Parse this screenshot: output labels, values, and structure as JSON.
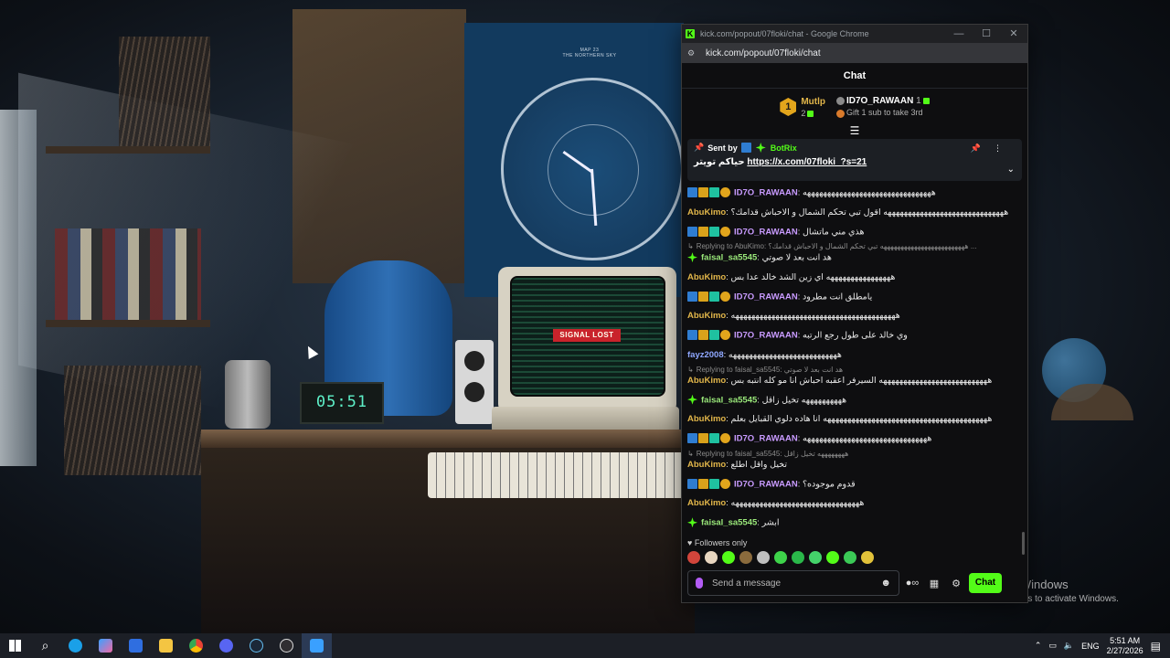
{
  "desktop": {
    "poster_title": "MAP 23\nTHE NORTHERN SKY",
    "alarm_time": "05:51",
    "screen_label": "SIGNAL LOST",
    "activate_line1": "Activate Windows",
    "activate_line2": "Go to Settings to activate Windows."
  },
  "window": {
    "title": "kick.com/popout/07floki/chat - Google Chrome",
    "url": "kick.com/popout/07floki/chat",
    "minimize_glyph": "—",
    "maximize_glyph": "☐",
    "close_glyph": "✕"
  },
  "chat": {
    "header": "Chat",
    "leaderboard": [
      {
        "rank": "1",
        "name": "Mutlp",
        "sub": "2"
      },
      {
        "name": "ID7O_RAWAAN",
        "count": "1",
        "sub": "Gift 1 sub to take 3rd"
      }
    ],
    "pinned": {
      "sent_by": "Sent by",
      "bot_name": "BotRix",
      "text": "حياكم تويتر",
      "link": "https://x.com/07floki_?s=21"
    },
    "messages": [
      {
        "user": "ID7O_RAWAAN",
        "color": "purple",
        "badges": [
          "blue",
          "gold",
          "teal",
          "coin"
        ],
        "text": "ههههههههههههههههههههههههههههههههه"
      },
      {
        "user": "AbuKimo",
        "color": "gold",
        "badges": [],
        "text": "ههههههههههههههههههههههههههههههه اقول تبي تحكم الشمال و الاحباش قدامك؟"
      },
      {
        "user": "ID7O_RAWAAN",
        "color": "purple",
        "badges": [
          "blue",
          "gold",
          "teal",
          "coin"
        ],
        "text": "هذي مني ماتشال"
      },
      {
        "reply": "Replying to AbuKimo: هههههههههههههههههههههههههه تبي تحكم الشمال و الاحباش قدامك؟ ...",
        "user": "faisal_sa5545",
        "color": "green",
        "badges": [
          "spark"
        ],
        "text": "هد انت بعد لا صوتي"
      },
      {
        "user": "AbuKimo",
        "color": "gold",
        "badges": [],
        "text": "ههههههههههههههههه اي زين الشد خالد عدا بس"
      },
      {
        "user": "ID7O_RAWAAN",
        "color": "purple",
        "badges": [
          "blue",
          "gold",
          "teal",
          "coin"
        ],
        "text": "يامطلق انت مطرود"
      },
      {
        "user": "AbuKimo",
        "color": "gold",
        "badges": [],
        "text": "هههههههههههههههههههههههههههههههههههههههههه"
      },
      {
        "user": "ID7O_RAWAAN",
        "color": "purple",
        "badges": [
          "blue",
          "gold",
          "teal",
          "coin"
        ],
        "text": "وي خالد على طول رجع الرتبه"
      },
      {
        "user": "fayz2008",
        "color": "blue",
        "badges": [],
        "text": "هههههههههههههههههههههههههههه"
      },
      {
        "reply": "Replying to faisal_sa5545: هد انت بعد لا صوتي",
        "user": "AbuKimo",
        "color": "gold",
        "badges": [],
        "text": "هههههههههههههههههههههههههههه السيرفر اعقبه احباش انا مو كله انتبه بس"
      },
      {
        "user": "faisal_sa5545",
        "color": "green",
        "badges": [
          "spark"
        ],
        "text": "ههههههههههه تخيل زاقل"
      },
      {
        "user": "AbuKimo",
        "color": "gold",
        "badges": [],
        "text": "هههههههههههههههههههههههههههههههههههههههههه انا هاده دلوي القبايل بعلم"
      },
      {
        "user": "ID7O_RAWAAN",
        "color": "purple",
        "badges": [
          "blue",
          "gold",
          "teal",
          "coin"
        ],
        "text": "هههههههههههههههههههههههههههههههه"
      },
      {
        "reply": "Replying to faisal_sa5545: ههههههههه تخيل زاقل",
        "user": "AbuKimo",
        "color": "gold",
        "badges": [],
        "text": "تخيل واقل اطلع"
      },
      {
        "user": "ID7O_RAWAAN",
        "color": "purple",
        "badges": [
          "blue",
          "gold",
          "teal",
          "coin"
        ],
        "text": "قدوم موجوده؟"
      },
      {
        "user": "AbuKimo",
        "color": "gold",
        "badges": [],
        "text": "ههههههههههههههههههههههههههههههههه"
      },
      {
        "user": "faisal_sa5545",
        "color": "green",
        "badges": [
          "spark"
        ],
        "text": "ابشر"
      }
    ],
    "followers_only": "Followers only",
    "input_placeholder": "Send a message",
    "chat_button": "Chat"
  },
  "taskbar": {
    "time": "5:51 AM",
    "date": "2/27/2026",
    "language": "ENG"
  }
}
